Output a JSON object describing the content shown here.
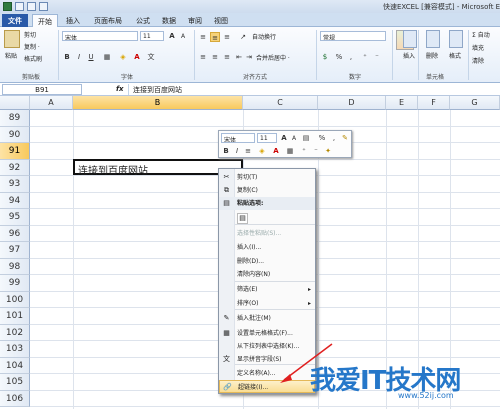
{
  "window": {
    "title": "快速EXCEL [兼容模式] - Microsoft Ex"
  },
  "tabs": [
    "文件",
    "开始",
    "插入",
    "页面布局",
    "公式",
    "数据",
    "审阅",
    "视图"
  ],
  "clipboard": {
    "paste": "粘贴",
    "cut": "剪切",
    "copy": "复制 ·",
    "format_painter": "格式刷",
    "group": "剪贴板"
  },
  "font": {
    "name": "宋体",
    "size": "11",
    "group": "字体"
  },
  "alignment": {
    "wrap": "自动换行",
    "merge": "合并后居中 ·",
    "group": "对齐方式"
  },
  "number": {
    "format": "常规",
    "percent": "%",
    "comma": ",",
    "group": "数字"
  },
  "cells": {
    "insert": "插入",
    "delete": "删除",
    "format": "格式",
    "group": "单元格"
  },
  "editing": {
    "autosum": "Σ 自动",
    "fill": "填充",
    "clear": "清除"
  },
  "formula_bar": {
    "name_box": "B91",
    "fx": "fx",
    "content": "连接到百度网站"
  },
  "columns": [
    "A",
    "B",
    "C",
    "D",
    "E",
    "F",
    "G"
  ],
  "rows": [
    "89",
    "90",
    "91",
    "92",
    "93",
    "94",
    "95",
    "96",
    "97",
    "98",
    "99",
    "100",
    "101",
    "102",
    "103",
    "104",
    "105",
    "106"
  ],
  "active_cell": {
    "ref": "B91",
    "value": "连接到百度网站"
  },
  "mini_toolbar": {
    "font": "宋体",
    "size": "11",
    "grow": "A",
    "shrink": "A",
    "percent": "%",
    "comma": ",",
    "bold": "B",
    "italic": "I",
    "align": "≡",
    "font_color_letter": "A"
  },
  "context_menu": [
    {
      "label": "剪切(T)",
      "icon": "✂",
      "type": "item"
    },
    {
      "label": "复制(C)",
      "icon": "⧉",
      "type": "item"
    },
    {
      "label": "粘贴选项:",
      "icon": "▤",
      "type": "header"
    },
    {
      "label": "",
      "icon": "▤",
      "type": "paste-icon"
    },
    {
      "label": "选择性粘贴(S)...",
      "icon": "",
      "type": "disabled"
    },
    {
      "label": "插入(I)...",
      "icon": "",
      "type": "item"
    },
    {
      "label": "删除(D)...",
      "icon": "",
      "type": "item"
    },
    {
      "label": "清除内容(N)",
      "icon": "",
      "type": "item"
    },
    {
      "label": "筛选(E)",
      "icon": "",
      "type": "submenu"
    },
    {
      "label": "排序(O)",
      "icon": "",
      "type": "submenu"
    },
    {
      "label": "插入批注(M)",
      "icon": "✎",
      "type": "item"
    },
    {
      "label": "设置单元格格式(F)...",
      "icon": "▦",
      "type": "item"
    },
    {
      "label": "从下拉列表中选择(K)...",
      "icon": "",
      "type": "item"
    },
    {
      "label": "显示拼音字段(S)",
      "icon": "文",
      "type": "item"
    },
    {
      "label": "定义名称(A)...",
      "icon": "",
      "type": "item"
    },
    {
      "label": "超链接(I)...",
      "icon": "🔗",
      "type": "highlight"
    }
  ],
  "watermark": {
    "text": "我爱IT技术网",
    "url": "www.52ij.com"
  },
  "colors": {
    "file_tab": "#2a5aa8",
    "selection": "#f8c95d",
    "arrow": "#e02020",
    "watermark": "#2577c9"
  }
}
